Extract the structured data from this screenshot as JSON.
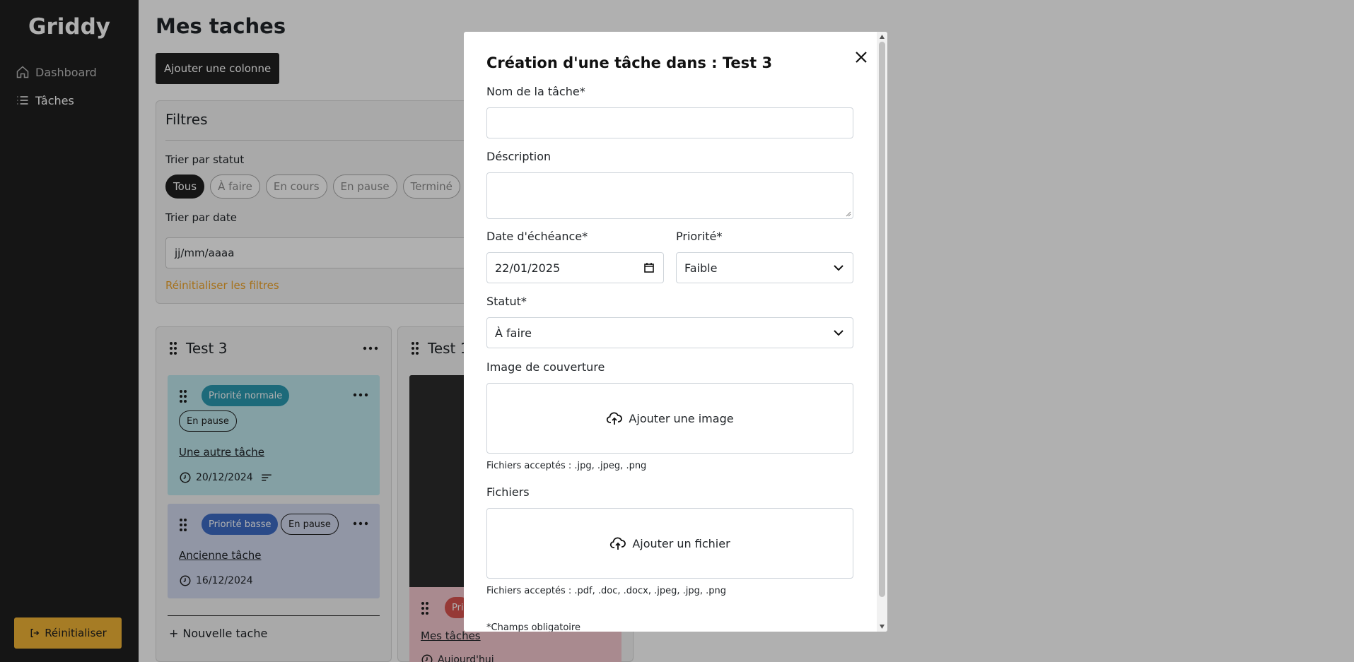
{
  "app": {
    "brand": "Griddy"
  },
  "sidebar": {
    "items": [
      {
        "label": "Dashboard",
        "icon": "home-icon"
      },
      {
        "label": "Tâches",
        "icon": "list-icon"
      }
    ],
    "reset_label": "Réinitialiser"
  },
  "main": {
    "title": "Mes taches",
    "add_column_label": "Ajouter une colonne",
    "filters": {
      "title": "Filtres",
      "sort_status_label": "Trier par statut",
      "chips": [
        "Tous",
        "À faire",
        "En cours",
        "En pause",
        "Terminé"
      ],
      "active_chip": "Tous",
      "sort_date_label": "Trier par date",
      "date_placeholder": "jj/mm/aaaa",
      "reset_label": "Réinitialiser les filtres"
    },
    "columns": [
      {
        "title": "Test 3",
        "cards": [
          {
            "priority": "Priorité normale",
            "status": "En pause",
            "title": "Une autre tâche",
            "date": "20/12/2024"
          },
          {
            "priority": "Priorité basse",
            "status": "En pause",
            "title": "Ancienne tâche",
            "date": "16/12/2024"
          }
        ],
        "new_task_label": "Nouvelle tache"
      },
      {
        "title": "Test 1",
        "card": {
          "priority": "Pri",
          "title": "Mes tâches",
          "sub": "Aujourd'hui"
        }
      }
    ]
  },
  "modal": {
    "title": "Création d'une tâche dans : Test 3",
    "name_label": "Nom de la tâche*",
    "description_label": "Déscription",
    "due_date_label": "Date d'échéance*",
    "due_date_value": "22/01/2025",
    "priority_label": "Priorité*",
    "priority_value": "Faible",
    "status_label": "Statut*",
    "status_value": "À faire",
    "cover_label": "Image de couverture",
    "cover_button": "Ajouter une image",
    "cover_hint": "Fichiers acceptés : .jpg, .jpeg, .png",
    "files_label": "Fichiers",
    "files_button": "Ajouter un fichier",
    "files_hint": "Fichiers acceptés : .pdf, .doc, .docx, .jpeg, .jpg, .png",
    "required_note": "*Champs obligatoire"
  },
  "colors": {
    "sidebar_bg": "#1f1f1f",
    "accent": "#f1b436",
    "priority_normal": "#2b9ab1",
    "priority_low": "#3d6cc6",
    "priority_high": "#d9534f"
  }
}
